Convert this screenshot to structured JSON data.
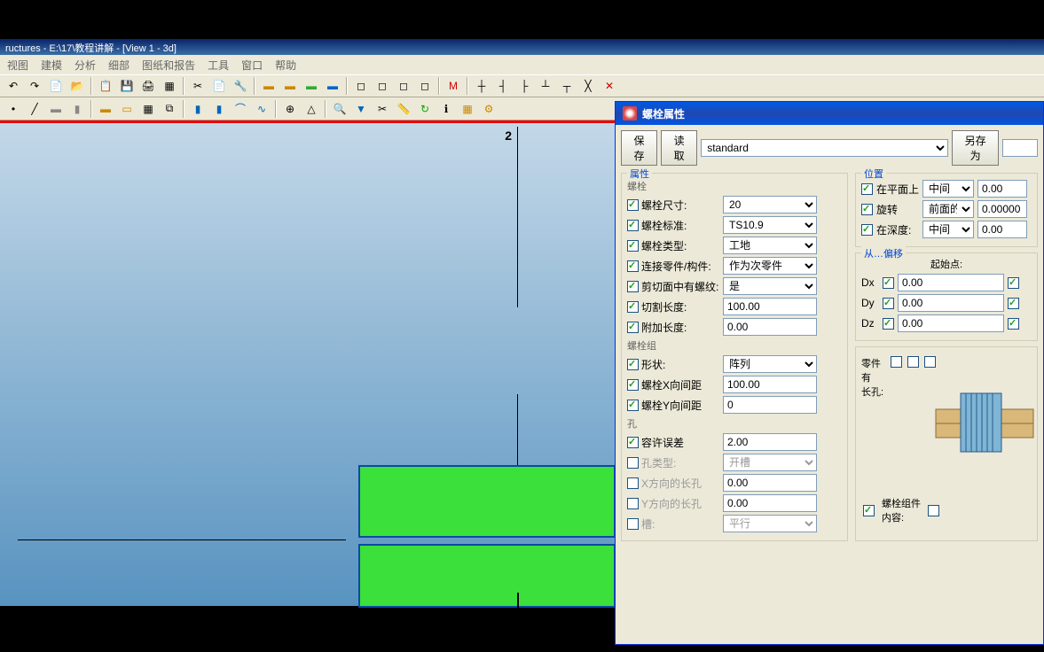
{
  "titlebar": "ructures - E:\\17\\教程讲解 - [View 1 - 3d]",
  "menu": [
    "视图",
    "建模",
    "分析",
    "细部",
    "图纸和报告",
    "工具",
    "窗口",
    "帮助"
  ],
  "viewport": {
    "label2": "2"
  },
  "dialog": {
    "title": "螺栓属性",
    "buttons": {
      "save": "保存",
      "load": "读取",
      "saveas": "另存为"
    },
    "preset": "standard",
    "groups": {
      "attrs": "属性",
      "bolt": "螺栓",
      "boltgroup": "螺栓组",
      "hole": "孔",
      "position": "位置",
      "offset": "从…偏移",
      "startpt": "起始点:"
    },
    "fields": {
      "boltSize": {
        "label": "螺栓尺寸:",
        "value": "20"
      },
      "boltStd": {
        "label": "螺栓标准:",
        "value": "TS10.9"
      },
      "boltType": {
        "label": "螺栓类型:",
        "value": "工地"
      },
      "connect": {
        "label": "连接零件/构件:",
        "value": "作为次零件"
      },
      "thread": {
        "label": "剪切面中有螺纹:",
        "value": "是"
      },
      "cutLen": {
        "label": "切割长度:",
        "value": "100.00"
      },
      "addLen": {
        "label": "附加长度:",
        "value": "0.00"
      },
      "shape": {
        "label": "形状:",
        "value": "阵列"
      },
      "xdist": {
        "label": "螺栓X向间距",
        "value": "100.00"
      },
      "ydist": {
        "label": "螺栓Y向间距",
        "value": "0"
      },
      "tol": {
        "label": "容许误差",
        "value": "2.00"
      },
      "holeType": {
        "label": "孔类型:",
        "value": "开槽"
      },
      "xslot": {
        "label": "X方向的长孔",
        "value": "0.00"
      },
      "yslot": {
        "label": "Y方向的长孔",
        "value": "0.00"
      },
      "slot": {
        "label": "槽:",
        "value": "平行"
      },
      "onPlane": {
        "label": "在平面上",
        "option": "中间",
        "value": "0.00"
      },
      "rotate": {
        "label": "旋转",
        "option": "前面的",
        "value": "0.00000"
      },
      "depth": {
        "label": "在深度:",
        "option": "中间",
        "value": "0.00"
      },
      "dx": {
        "label": "Dx",
        "value": "0.00"
      },
      "dy": {
        "label": "Dy",
        "value": "0.00"
      },
      "dz": {
        "label": "Dz",
        "value": "0.00"
      },
      "partHasSlot": "零件\n有\n长孔:",
      "boltGroupContent": "螺栓组件\n内容:"
    }
  }
}
